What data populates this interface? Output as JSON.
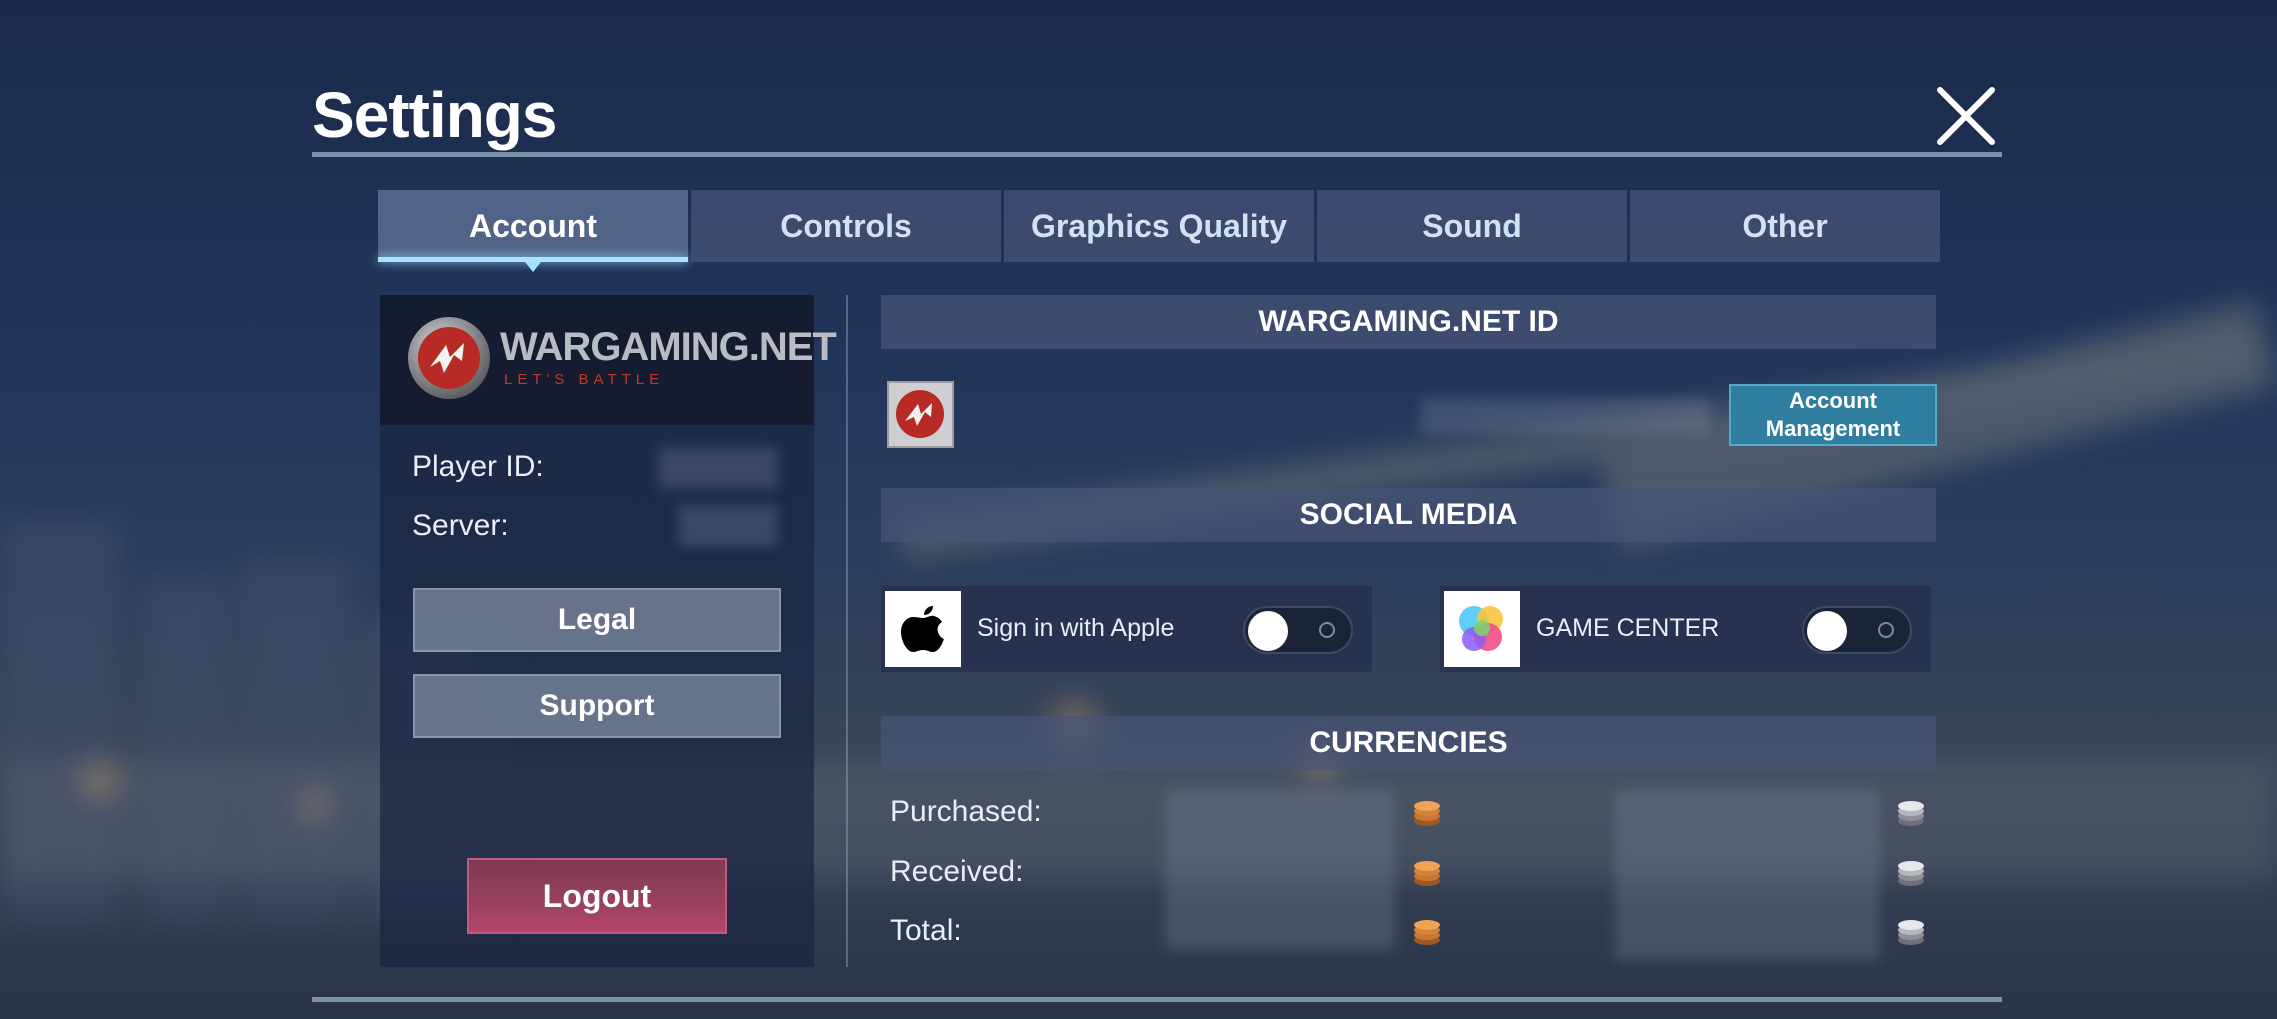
{
  "window": {
    "title": "Settings"
  },
  "tabs": [
    {
      "label": "Account",
      "active": true
    },
    {
      "label": "Controls",
      "active": false
    },
    {
      "label": "Graphics Quality",
      "active": false
    },
    {
      "label": "Sound",
      "active": false
    },
    {
      "label": "Other",
      "active": false
    }
  ],
  "account": {
    "logo_text": "WARGAMING.NET",
    "logo_tagline": "LET'S BATTLE",
    "player_id_label": "Player ID:",
    "server_label": "Server:",
    "legal_label": "Legal",
    "support_label": "Support",
    "logout_label": "Logout"
  },
  "wargaming_id": {
    "heading": "WARGAMING.NET ID",
    "account_management_line1": "Account",
    "account_management_line2": "Management"
  },
  "social_media": {
    "heading": "SOCIAL MEDIA",
    "items": [
      {
        "label": "Sign in with Apple",
        "icon": "apple-icon",
        "enabled": false
      },
      {
        "label": "GAME CENTER",
        "icon": "game-center-icon",
        "enabled": false
      }
    ]
  },
  "currencies": {
    "heading": "CURRENCIES",
    "rows": [
      {
        "label": "Purchased:"
      },
      {
        "label": "Received:"
      },
      {
        "label": "Total:"
      }
    ],
    "icons": [
      "gold-coin-icon",
      "silver-coin-icon"
    ]
  },
  "colors": {
    "accent_tab": "#a8e4ff",
    "account_button": "#2f7d9f",
    "logout_button": "#99415f",
    "gold": "#d4823a",
    "silver": "#b5b8be"
  }
}
